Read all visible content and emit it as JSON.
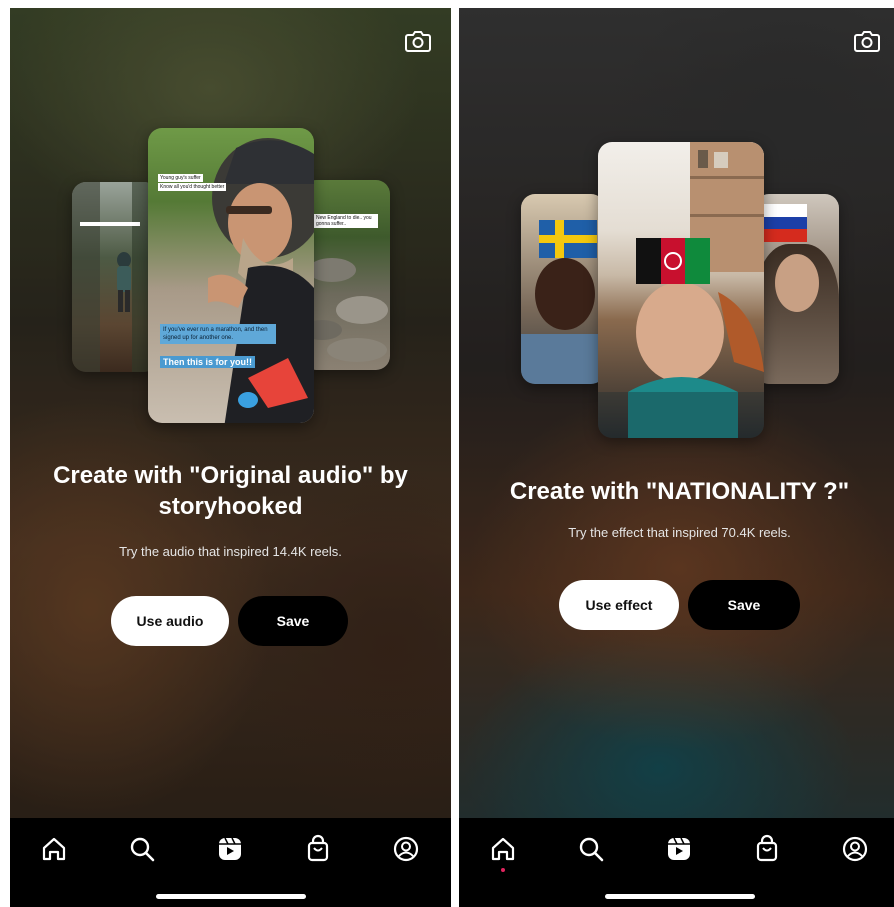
{
  "left": {
    "title": "Create with \"Original audio\" by storyhooked",
    "subtitle": "Try the audio that inspired 14.4K reels.",
    "primary_button": "Use audio",
    "secondary_button": "Save",
    "preview": {
      "center_label_top": "Young guy's suffer",
      "center_label_top2": "Know all you'd thought better",
      "caption_small": "If you've ever run a marathon, and then signed up for another one.",
      "caption_big": "Then this is for you!!",
      "right_label": "New England to die.. you gonna suffer.."
    }
  },
  "right": {
    "title": "Create with \"NATIONALITY ?\"",
    "subtitle": "Try the effect that inspired 70.4K reels.",
    "primary_button": "Use effect",
    "secondary_button": "Save"
  },
  "nav": {
    "items": [
      "home-icon",
      "search-icon",
      "reels-icon",
      "shop-icon",
      "profile-icon"
    ]
  },
  "colors": {
    "nav_bg": "#000000",
    "button_white": "#ffffff",
    "button_black": "#000000",
    "notification_dot": "#e0245e"
  }
}
